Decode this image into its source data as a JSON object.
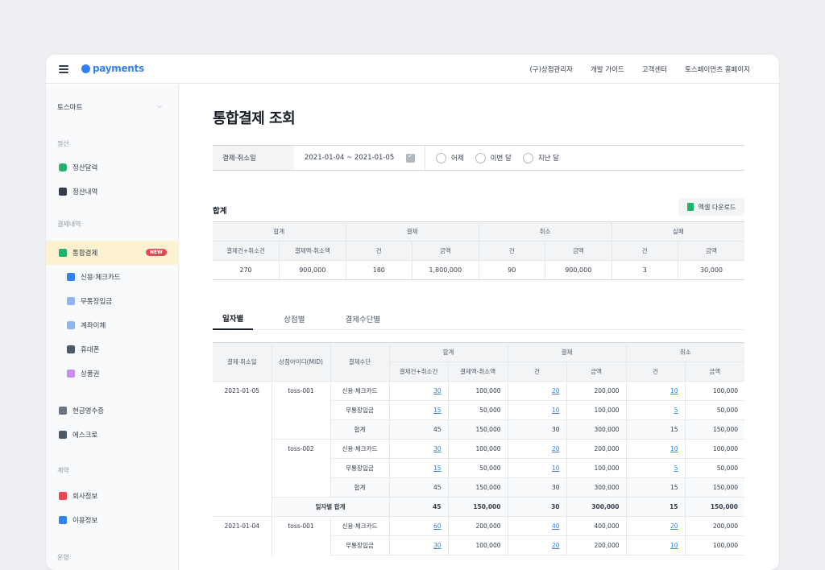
{
  "topbar": {
    "logo": "payments",
    "nav": [
      "(구)상점관리자",
      "개발 가이드",
      "고객센터",
      "토스페이먼츠 홈페이지"
    ]
  },
  "sidebar": {
    "store": "토스마트",
    "sections": {
      "settle": "정산",
      "payments": "결제내역",
      "contract": "계약",
      "ops": "운영"
    },
    "items": {
      "settle_calendar": "정산달력",
      "settle_history": "정산내역",
      "unified": "통합결제",
      "new_badge": "NEW",
      "card": "신용·체크카드",
      "bank_deposit": "무통장입금",
      "transfer": "계좌이체",
      "phone": "휴대폰",
      "voucher": "상품권",
      "cash_receipt": "현금영수증",
      "escrow": "에스크로",
      "company": "회사정보",
      "usage": "이용정보"
    }
  },
  "main": {
    "title": "통합결제 조회",
    "filter": {
      "label": "결제·취소일",
      "date_range": "2021-01-04 ~ 2021-01-05",
      "options": [
        "어제",
        "이번 달",
        "지난 달"
      ]
    },
    "summary_label": "합계",
    "excel_button": "엑셀 다운로드",
    "summary": {
      "groups": [
        "합계",
        "결제",
        "취소",
        "실패"
      ],
      "sub": [
        "결제건+취소건",
        "결제액-취소액",
        "건",
        "금액",
        "건",
        "금액",
        "건",
        "금액"
      ],
      "values": [
        "270",
        "900,000",
        "180",
        "1,800,000",
        "90",
        "900,000",
        "3",
        "30,000"
      ]
    },
    "tabs": [
      "일자별",
      "상점별",
      "결제수단별"
    ],
    "detail": {
      "h": {
        "date": "결제·취소일",
        "mid": "상점아이디(MID)",
        "method": "결제수단",
        "total": "합계",
        "pay": "결제",
        "cancel": "취소",
        "total_cnt": "결제건+취소건",
        "total_amt": "결제액-취소액",
        "cnt": "건",
        "amt": "금액"
      },
      "d1": "2021-01-05",
      "d2": "2021-01-04",
      "mid1": "toss-001",
      "mid2": "toss-002",
      "m_card": "신용·체크카드",
      "m_bank": "무통장입금",
      "m_sum": "합계",
      "day_total": "일자별 합계",
      "rows": [
        [
          "30",
          "100,000",
          "20",
          "200,000",
          "10",
          "100,000"
        ],
        [
          "15",
          "50,000",
          "10",
          "100,000",
          "5",
          "50,000"
        ],
        [
          "45",
          "150,000",
          "30",
          "300,000",
          "15",
          "150,000"
        ],
        [
          "30",
          "100,000",
          "20",
          "200,000",
          "10",
          "100,000"
        ],
        [
          "15",
          "50,000",
          "10",
          "100,000",
          "5",
          "50,000"
        ],
        [
          "45",
          "150,000",
          "30",
          "300,000",
          "15",
          "150,000"
        ],
        [
          "45",
          "150,000",
          "30",
          "300,000",
          "15",
          "150,000"
        ],
        [
          "60",
          "200,000",
          "40",
          "400,000",
          "20",
          "200,000"
        ],
        [
          "30",
          "100,000",
          "20",
          "200,000",
          "10",
          "100,000"
        ]
      ]
    }
  },
  "colors": {
    "accent": "#3182f6",
    "active_bg": "#fdf2cf",
    "badge": "#f04452",
    "excel": "#20b36b"
  }
}
